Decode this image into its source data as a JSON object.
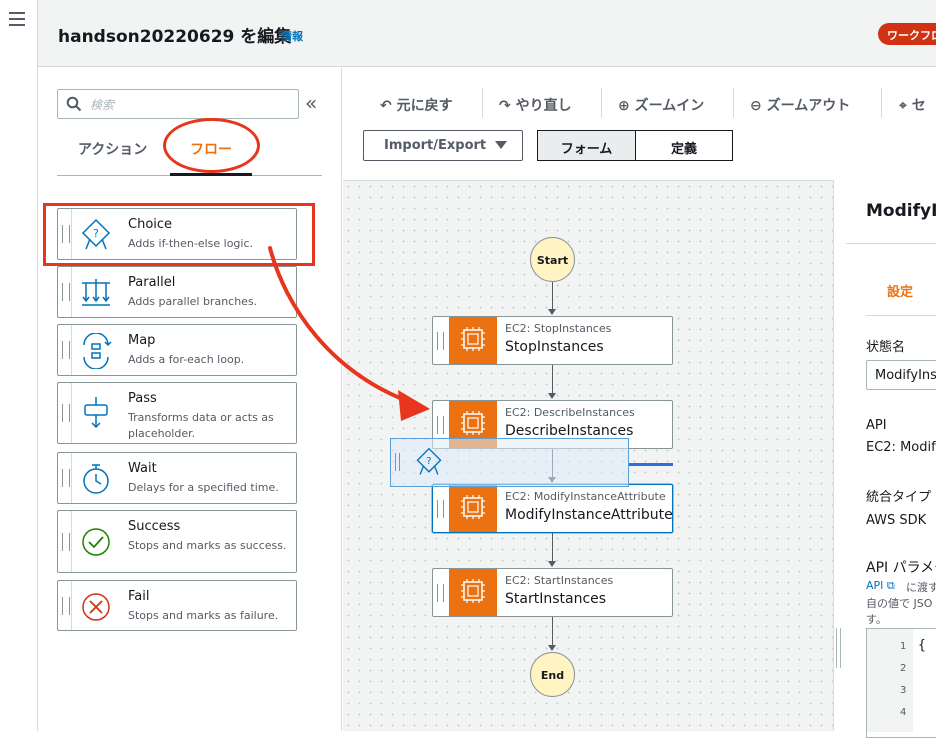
{
  "header": {
    "title": "handson20220629 を編集",
    "info_link": "情報",
    "workflow_badge": "ワークフロー"
  },
  "states_panel": {
    "search_placeholder": "検索",
    "tabs": [
      {
        "label": "アクション",
        "active": false
      },
      {
        "label": "フロー",
        "active": true
      }
    ],
    "flow_states": [
      {
        "title": "Choice",
        "desc": "Adds if-then-else logic.",
        "icon": "choice-icon"
      },
      {
        "title": "Parallel",
        "desc": "Adds parallel branches.",
        "icon": "parallel-icon"
      },
      {
        "title": "Map",
        "desc": "Adds a for-each loop.",
        "icon": "map-icon"
      },
      {
        "title": "Pass",
        "desc": "Transforms data or acts as placeholder.",
        "icon": "pass-icon"
      },
      {
        "title": "Wait",
        "desc": "Delays for a specified time.",
        "icon": "stopwatch-icon"
      },
      {
        "title": "Success",
        "desc": "Stops and marks as success.",
        "icon": "success-icon"
      },
      {
        "title": "Fail",
        "desc": "Stops and marks as failure.",
        "icon": "fail-icon"
      }
    ]
  },
  "toolbar": {
    "undo": "元に戻す",
    "redo": "やり直し",
    "zoom_in": "ズームイン",
    "zoom_out": "ズームアウト",
    "center": "セ",
    "import_export": "Import/Export",
    "view_form": "フォーム",
    "view_definition": "定義"
  },
  "graph": {
    "start": "Start",
    "end": "End",
    "nodes": [
      {
        "type": "EC2: StopInstances",
        "name": "StopInstances",
        "selected": false
      },
      {
        "type": "EC2: DescribeInstances",
        "name": "DescribeInstances",
        "selected": false
      },
      {
        "type": "EC2: ModifyInstanceAttribute",
        "name": "ModifyInstanceAttribute",
        "selected": true
      },
      {
        "type": "EC2: StartInstances",
        "name": "StartInstances",
        "selected": false
      }
    ]
  },
  "inspector": {
    "title": "ModifyIn",
    "tab_settings": "設定",
    "state_name_label": "状態名",
    "state_name_value": "ModifyIns",
    "api_label": "API",
    "api_value": "EC2: Modify",
    "integration_label": "統合タイプ",
    "integration_value": "AWS SDK",
    "api_params_label": "API パラメー",
    "api_params_help_link": "API",
    "api_params_help_1": "に渡す",
    "api_params_help_2": "自の値で JSO",
    "api_params_help_3": "す。",
    "code_lines": [
      "1",
      "2",
      "3",
      "4"
    ],
    "code_first": "{"
  },
  "colors": {
    "accent": "#ec7211",
    "annotation_red": "#e8361e",
    "link_blue": "#0073bb"
  }
}
